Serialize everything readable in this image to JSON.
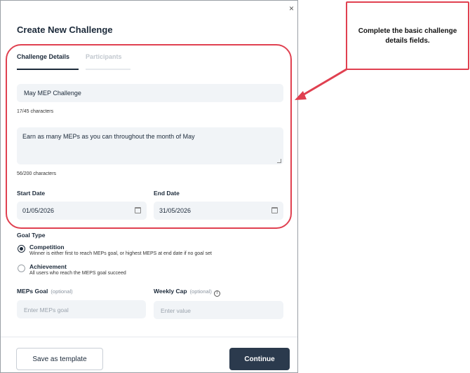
{
  "dialog": {
    "title": "Create New Challenge",
    "close_glyph": "×",
    "tabs": [
      {
        "label": "Challenge Details",
        "active": true
      },
      {
        "label": "Participants",
        "active": false
      }
    ],
    "name_field": {
      "value": "May MEP Challenge",
      "counter": "17/45 characters"
    },
    "description_field": {
      "value": "Earn as many MEPs as you can throughout the month of May",
      "counter": "56/200 characters"
    },
    "start_date": {
      "label": "Start Date",
      "value": "01/05/2026",
      "icon": "calendar-icon"
    },
    "end_date": {
      "label": "End Date",
      "value": "31/05/2026",
      "icon": "calendar-icon"
    },
    "goal_type": {
      "label": "Goal Type",
      "options": [
        {
          "title": "Competition",
          "description": "Winner is either first to reach MEPs goal, or highest MEPS at end date if no goal set",
          "selected": true
        },
        {
          "title": "Achievement",
          "description": "All users who reach the MEPS goal succeed",
          "selected": false
        }
      ]
    },
    "meps_goal": {
      "label": "MEPs Goal",
      "optional": "(optional)",
      "placeholder": "Enter MEPs goal"
    },
    "weekly_cap": {
      "label": "Weekly Cap",
      "optional": "(optional)",
      "placeholder": "Enter value",
      "info_glyph": "!"
    },
    "buttons": {
      "save_template": "Save as template",
      "continue": "Continue"
    }
  },
  "annotation": {
    "callout_text": "Complete the basic challenge details fields.",
    "color": "#e04050"
  },
  "colors": {
    "primary": "#2b3a4d",
    "field_bg": "#f1f4f7",
    "annotation": "#e04050"
  }
}
